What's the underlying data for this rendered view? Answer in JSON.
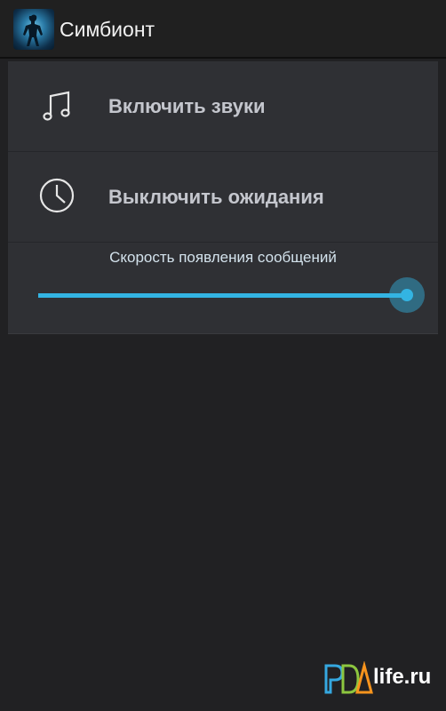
{
  "app": {
    "title": "Симбионт",
    "icon": "app-icon"
  },
  "settings": [
    {
      "icon": "music-note-icon",
      "label": "Включить звуки"
    },
    {
      "icon": "clock-icon",
      "label": "Выключить ожидания"
    }
  ],
  "slider": {
    "label": "Скорость появления сообщений",
    "value_fraction": 1.0
  },
  "watermark": {
    "logo_text": "PDA",
    "text": "life.ru"
  },
  "colors": {
    "accent": "#33b4e3",
    "background": "#212123",
    "panel": "#2f3034"
  }
}
